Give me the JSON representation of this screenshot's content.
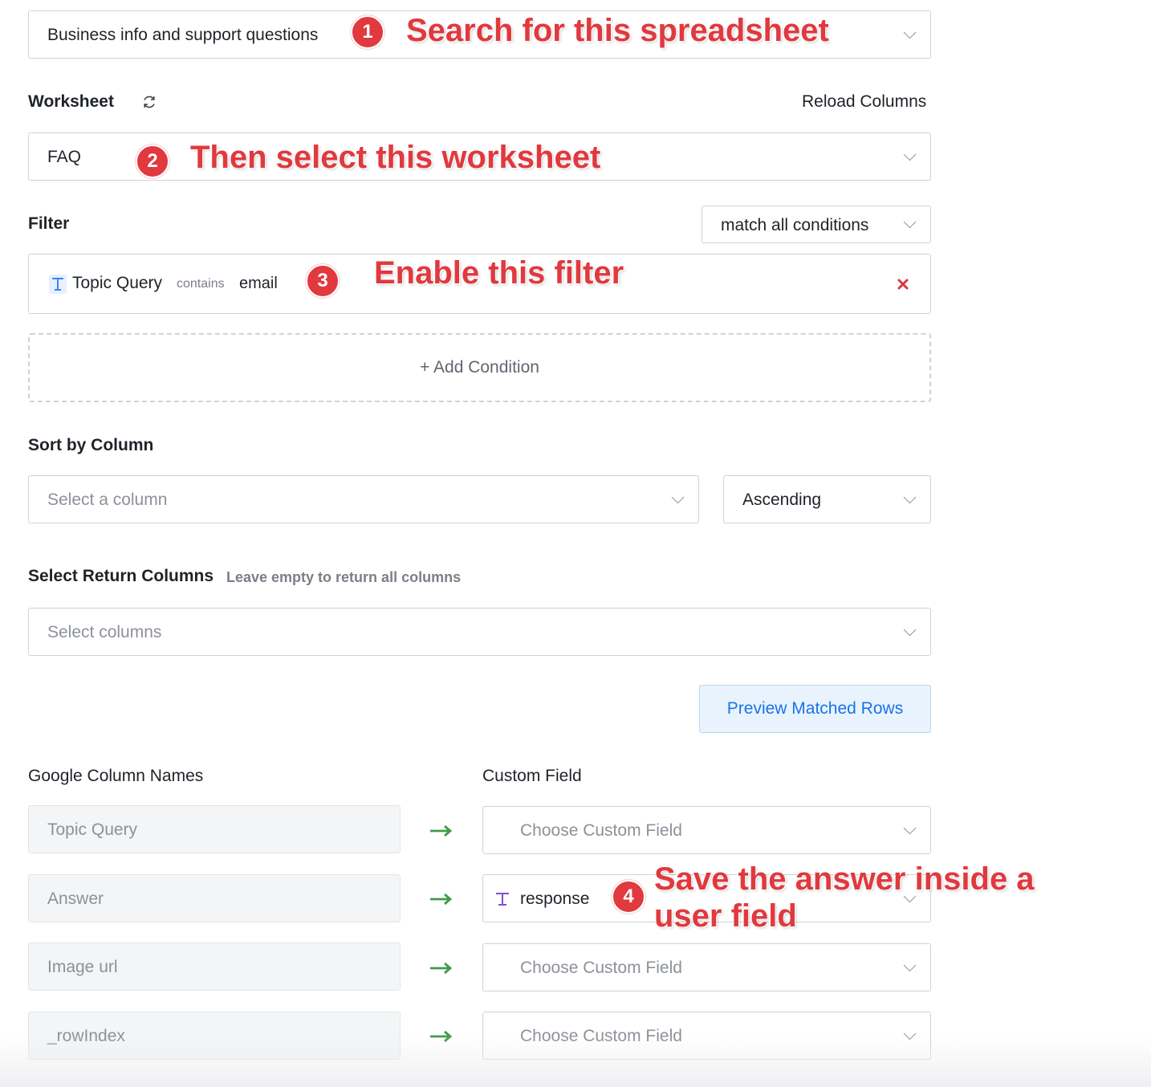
{
  "spreadsheet": {
    "value": "Business info and support questions",
    "badge": "1",
    "annotation": "Search for this spreadsheet"
  },
  "worksheet": {
    "label": "Worksheet",
    "reload_label": "Reload Columns",
    "value": "FAQ",
    "badge": "2",
    "annotation": "Then select this worksheet"
  },
  "filter": {
    "label": "Filter",
    "match_value": "match all conditions",
    "condition": {
      "field": "Topic Query",
      "operator": "contains",
      "value": "email"
    },
    "badge": "3",
    "annotation": "Enable this filter",
    "add_condition_label": "+ Add Condition"
  },
  "sort": {
    "label": "Sort by Column",
    "column_placeholder": "Select a column",
    "order_value": "Ascending"
  },
  "return_columns": {
    "label": "Select Return Columns",
    "hint": "Leave empty to return all columns",
    "placeholder": "Select columns"
  },
  "preview_button": "Preview Matched Rows",
  "mapping": {
    "google_header": "Google Column Names",
    "custom_header": "Custom Field",
    "rows": [
      {
        "google": "Topic Query",
        "custom": "",
        "custom_placeholder": "Choose Custom Field"
      },
      {
        "google": "Answer",
        "custom": "response",
        "custom_placeholder": ""
      },
      {
        "google": "Image url",
        "custom": "",
        "custom_placeholder": "Choose Custom Field"
      },
      {
        "google": "_rowIndex",
        "custom": "",
        "custom_placeholder": "Choose Custom Field"
      }
    ],
    "badge": "4",
    "annotation_line1": "Save the answer inside a",
    "annotation_line2": "user field"
  },
  "colors": {
    "annotation_red": "#e0393e",
    "arrow_green": "#3f9b4a",
    "preview_bg": "#e8f3fd",
    "preview_text": "#1a73e8",
    "remove_x": "#d9363e",
    "text_icon_purple": "#7b4fd6",
    "text_icon_blue": "#3b82f6"
  },
  "icons": {
    "refresh": "refresh-icon",
    "dropdown": "chevron-down-icon",
    "text_type": "text-type-icon",
    "remove": "close-icon",
    "map_arrow": "arrow-right-icon"
  }
}
